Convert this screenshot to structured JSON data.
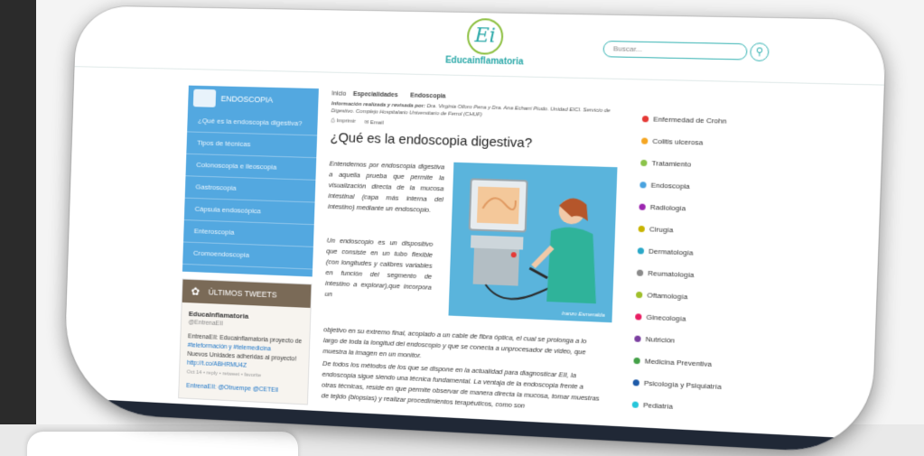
{
  "header": {
    "logo_mark": "Ei",
    "logo_text": "Educainflamatoria",
    "search_placeholder": "Buscar..."
  },
  "sidebar": {
    "section_title": "ENDOSCOPIA",
    "items": [
      {
        "label": "¿Qué es la endoscopia digestiva?"
      },
      {
        "label": "Tipos de técnicas"
      },
      {
        "label": "Colonoscopia e ileoscopia"
      },
      {
        "label": "Gastroscopia"
      },
      {
        "label": "Cápsula endoscópica"
      },
      {
        "label": "Enteroscopia"
      },
      {
        "label": "Cromoendoscopia"
      }
    ],
    "tweets": {
      "title": "ÚLTIMOS TWEETS",
      "name": "EducaInflamatoria",
      "handle": "@EntrenaEII",
      "text1": "EntrenaEII: Educainflamatoria proyecto de",
      "link1": "#teleformación y #telemedicina",
      "text2": "Nuevos Unidades adheridas al proyecto!",
      "link2": "http://t.co/ABHRMU4Z",
      "meta": "Oct 14 • reply • retweet • favorite",
      "text3": "EntrenaEII: @Otruempe @CETEII"
    }
  },
  "main": {
    "crumb_home": "Inicio",
    "crumb_section": "Especialidades",
    "crumb_page": "Endoscopia",
    "author_label": "Información realizada y revisada por:",
    "author_text": "Dra. Virginia Olloro Pena y Dra. Ana Echarri Piudo. Unidad EICI. Servicio de Digestivo. Complejo Hospitalario Universitario de Ferrol (CHUF)",
    "print_label": "Imprimir",
    "email_label": "Email",
    "title": "¿Qué es la endoscopia digestiva?",
    "p1": "Entendemos por endoscopia digestiva a aquella prueba que permite la visualización directa de la mucosa intestinal (capa más interna del intestino) mediante un endoscopio.",
    "p2": "Un endoscopio es un dispositivo que consiste en un tubo flexible (con longitudes y calibres variables en función del segmento de intestino a explorar),que incorpora un",
    "p3": "objetivo en su extremo final, acoplado a un cable de fibra óptica, el cual se prolonga a lo largo de toda la longitud del endoscopio y que se conecta a unprocesador de video, que muestra la imagen en un monitor.",
    "p4": "De todos los métodos de los que se dispone en la actualidad para diagnosticar EII, la endoscopia sigue siendo una técnica fundamental. La ventaja de la endoscopia frente a otras técnicas, reside en que permite observar de manera directa la mucosa, tomar muestras de tejido (biopsias) y realizar procedimientos terapéuticos, como son",
    "illustration_signature": "Iranzo Esmeralda"
  },
  "specialties": [
    {
      "label": "Enfermedad de Crohn",
      "color": "#e53935"
    },
    {
      "label": "Colitis ulcerosa",
      "color": "#f5a623"
    },
    {
      "label": "Tratamiento",
      "color": "#8bc34a"
    },
    {
      "label": "Endoscopia",
      "color": "#4aa3df"
    },
    {
      "label": "Radiología",
      "color": "#9c27b0"
    },
    {
      "label": "Cirugía",
      "color": "#c8b400"
    },
    {
      "label": "Dermatología",
      "color": "#2aa8c8"
    },
    {
      "label": "Reumatología",
      "color": "#8a8a8a"
    },
    {
      "label": "Oftamología",
      "color": "#9fbf2a"
    },
    {
      "label": "Ginecología",
      "color": "#e91e63"
    },
    {
      "label": "Nutrición",
      "color": "#7b3fa0"
    },
    {
      "label": "Medicina Preventiva",
      "color": "#43a047"
    },
    {
      "label": "Psicología y Psiquiatría",
      "color": "#1e5aa8"
    },
    {
      "label": "Pediatría",
      "color": "#26c6da"
    }
  ]
}
